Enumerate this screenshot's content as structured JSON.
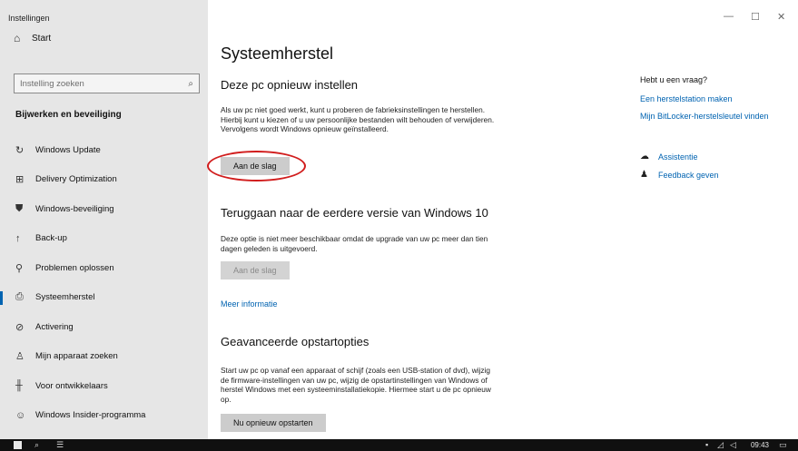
{
  "app_title": "Instellingen",
  "window_controls": {
    "minimize": "—",
    "maximize": "☐",
    "close": "✕"
  },
  "sidebar": {
    "home": {
      "icon": "home-icon",
      "label": "Start"
    },
    "search": {
      "placeholder": "Instelling zoeken",
      "icon": "search-icon"
    },
    "section": "Bijwerken en beveiliging",
    "items": [
      {
        "icon": "refresh-icon",
        "label": "Windows Update"
      },
      {
        "icon": "delivery-optimization-icon",
        "label": "Delivery Optimization"
      },
      {
        "icon": "shield-icon",
        "label": "Windows-beveiliging"
      },
      {
        "icon": "backup-icon",
        "label": "Back-up"
      },
      {
        "icon": "wrench-icon",
        "label": "Problemen oplossen"
      },
      {
        "icon": "recovery-icon",
        "label": "Systeemherstel",
        "selected": true
      },
      {
        "icon": "activation-icon",
        "label": "Activering"
      },
      {
        "icon": "find-device-icon",
        "label": "Mijn apparaat zoeken"
      },
      {
        "icon": "developer-icon",
        "label": "Voor ontwikkelaars"
      },
      {
        "icon": "insider-icon",
        "label": "Windows Insider-programma"
      }
    ]
  },
  "main": {
    "title": "Systeemherstel",
    "reset": {
      "heading": "Deze pc opnieuw instellen",
      "text": "Als uw pc niet goed werkt, kunt u proberen de fabrieksinstellingen te herstellen. Hierbij kunt u kiezen of u uw persoonlijke bestanden wilt behouden of verwijderen. Vervolgens wordt Windows opnieuw geïnstalleerd.",
      "button": "Aan de slag"
    },
    "goback": {
      "heading": "Teruggaan naar de eerdere versie van Windows 10",
      "text": "Deze optie is niet meer beschikbaar omdat de upgrade van uw pc meer dan tien dagen geleden is uitgevoerd.",
      "button": "Aan de slag",
      "link": "Meer informatie"
    },
    "advanced": {
      "heading": "Geavanceerde opstartopties",
      "text": "Start uw pc op vanaf een apparaat of schijf (zoals een USB-station of dvd), wijzig de firmware-instellingen van uw pc, wijzig de opstartinstellingen van Windows of herstel Windows met een systeeminstallatiekopie. Hiermee start u de pc opnieuw op.",
      "button": "Nu opnieuw opstarten"
    }
  },
  "aside": {
    "title": "Hebt u een vraag?",
    "links": [
      "Een herstelstation maken",
      "Mijn BitLocker-herstelsleutel vinden"
    ],
    "help": [
      {
        "icon": "chat-help-icon",
        "label": "Assistentie"
      },
      {
        "icon": "feedback-icon",
        "label": "Feedback geven"
      }
    ]
  },
  "taskbar": {
    "time": "09:43"
  },
  "colors": {
    "accent": "#0063b1",
    "sidebar_bg": "#e6e6e6",
    "highlight_ring": "#d11d1d"
  }
}
